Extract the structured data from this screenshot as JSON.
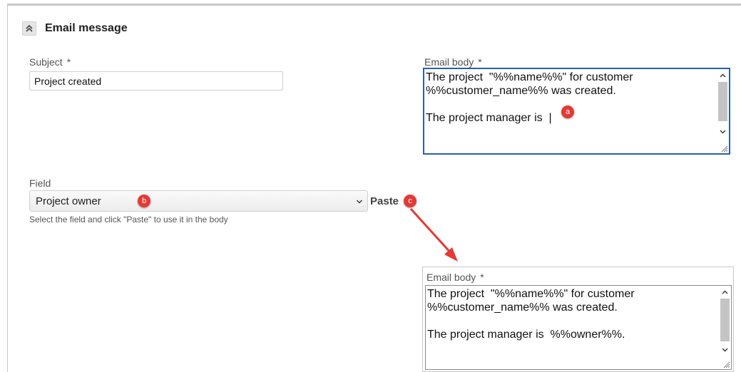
{
  "section": {
    "title": "Email message",
    "collapse_icon": "chevrons-up-icon"
  },
  "subject": {
    "label": "Subject",
    "required_mark": "*",
    "value": "Project created"
  },
  "email_body": {
    "label": "Email body",
    "required_mark": "*",
    "lines": [
      "The project  \"%%name%%\" for customer",
      "%%customer_name%% was created.",
      "",
      "The project manager is  |"
    ]
  },
  "field": {
    "label": "Field",
    "selected": "Project owner",
    "paste_label": "Paste",
    "hint": "Select the field and click \"Paste\" to use it in the body"
  },
  "result_body": {
    "label": "Email body",
    "required_mark": "*",
    "lines": [
      "The project  \"%%name%%\" for customer",
      "%%customer_name%% was created.",
      "",
      "The project manager is  %%owner%%."
    ]
  },
  "annotations": {
    "a": "a",
    "b": "b",
    "c": "c",
    "color": "#e53935",
    "arrow_color": "#e53935"
  },
  "colors": {
    "focus_border": "#2a5fb0",
    "border": "#d0d0d0"
  }
}
